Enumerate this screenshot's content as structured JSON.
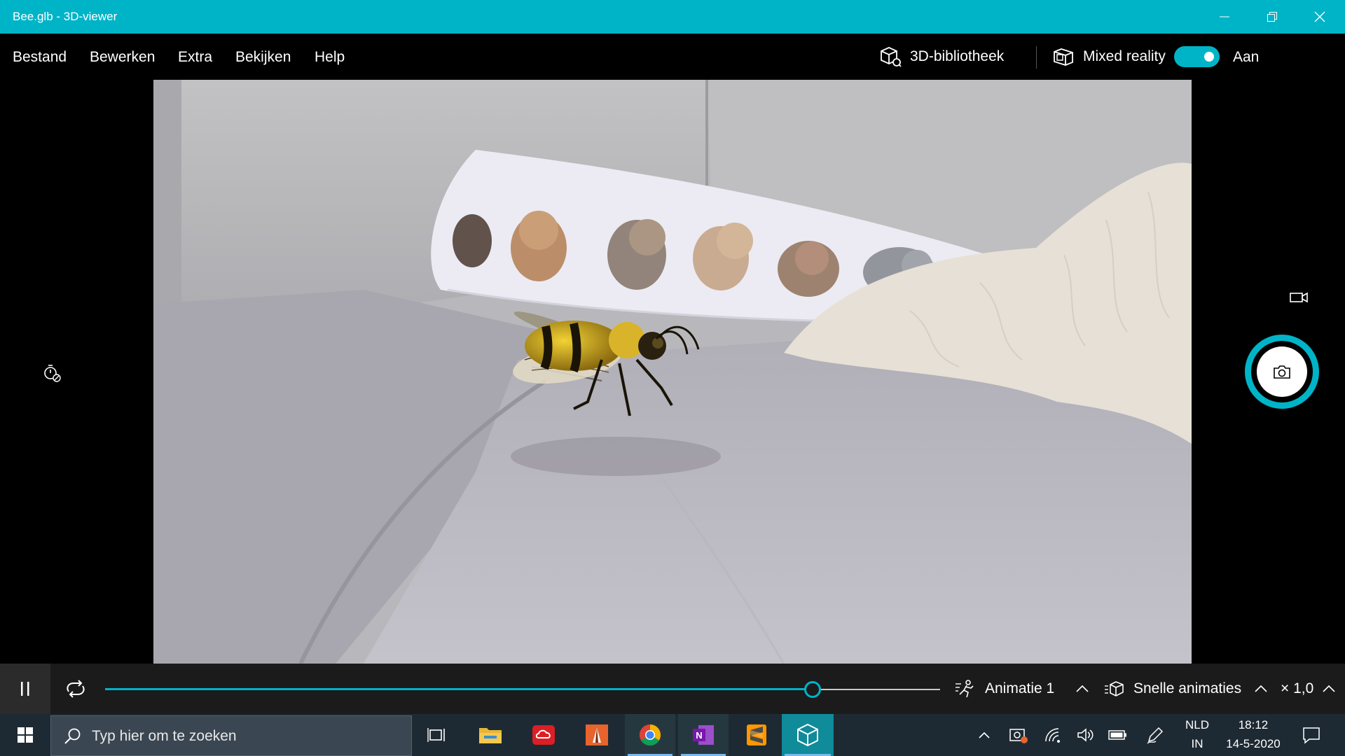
{
  "window": {
    "title": "Bee.glb - 3D-viewer",
    "accent_color": "#00b4c8"
  },
  "menu": {
    "items": [
      "Bestand",
      "Bewerken",
      "Extra",
      "Bekijken",
      "Help"
    ],
    "library_label": "3D-bibliotheek",
    "mixed_reality_label": "Mixed reality",
    "mixed_reality_toggle": {
      "on": true,
      "state_label": "Aan"
    }
  },
  "viewport": {
    "scene": "camera view of a grey couch with a kittens pillow and a 3D bee model",
    "icons": {
      "timer": "timer-off-icon",
      "video": "video-camera-icon",
      "capture": "camera-icon"
    }
  },
  "animation_bar": {
    "progress": 0.847,
    "animation_name": "Animatie 1",
    "quick_animations_label": "Snelle animaties",
    "speed_label": "× 1,0"
  },
  "taskbar": {
    "search_placeholder": "Typ hier om te zoeken",
    "apps": [
      "task-view",
      "file-explorer",
      "creative-cloud",
      "paint-app",
      "chrome",
      "onenote",
      "sublime-text",
      "3d-viewer"
    ],
    "active_app": "3d-viewer",
    "language": "NLD",
    "input_mode": "IN",
    "time": "18:12",
    "date": "14-5-2020"
  }
}
